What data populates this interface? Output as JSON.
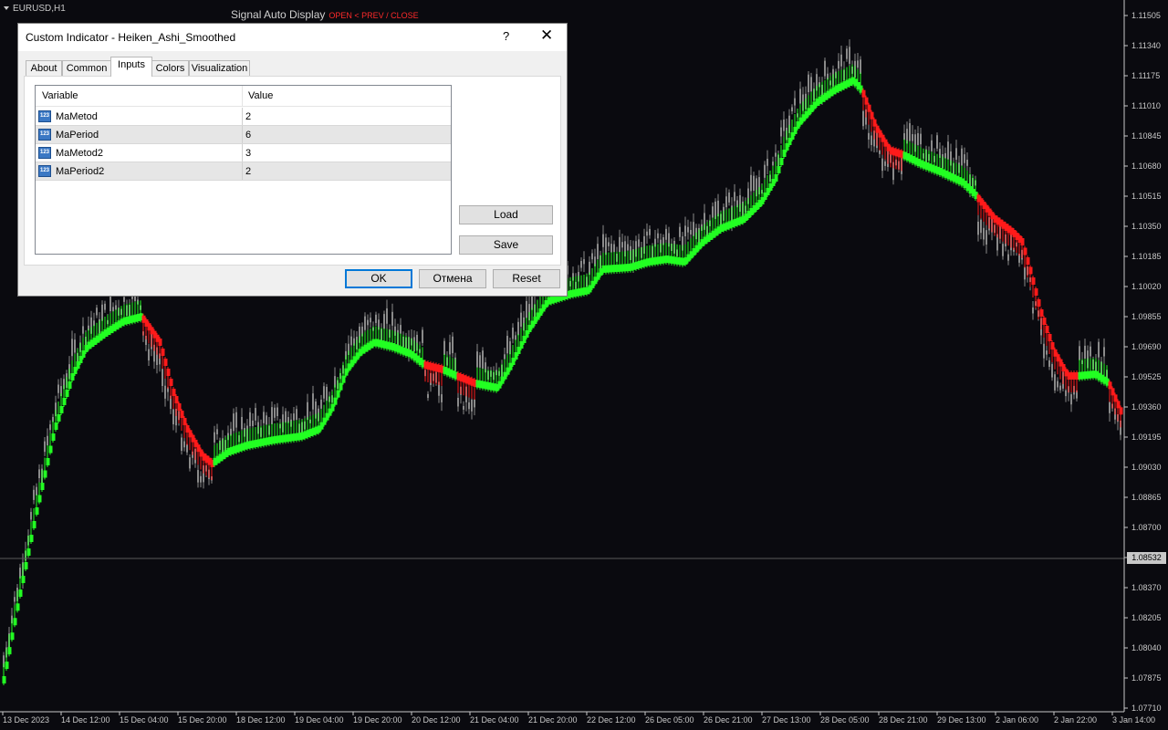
{
  "chart": {
    "symbol": "EURUSD,H1",
    "indicator_label": "Signal Auto Display",
    "indicator_hint": "OPEN < PREV / CLOSE",
    "bull_color": "#22ff22",
    "bear_color": "#ff1a1a",
    "candle_color": "#8a8a8a",
    "current_price": "1.08532",
    "price_axis": [
      "1.11505",
      "1.11340",
      "1.11175",
      "1.11010",
      "1.10845",
      "1.10680",
      "1.10515",
      "1.10350",
      "1.10185",
      "1.10020",
      "1.09855",
      "1.09690",
      "1.09525",
      "1.09360",
      "1.09195",
      "1.09030",
      "1.08865",
      "1.08700",
      "1.08535",
      "1.08370",
      "1.08205",
      "1.08040",
      "1.07875",
      "1.07710"
    ],
    "time_axis": [
      "13 Dec 2023",
      "14 Dec 12:00",
      "15 Dec 04:00",
      "15 Dec 20:00",
      "18 Dec 12:00",
      "19 Dec 04:00",
      "19 Dec 20:00",
      "20 Dec 12:00",
      "21 Dec 04:00",
      "21 Dec 20:00",
      "22 Dec 12:00",
      "26 Dec 05:00",
      "26 Dec 21:00",
      "27 Dec 13:00",
      "28 Dec 05:00",
      "28 Dec 21:00",
      "29 Dec 13:00",
      "2 Jan 06:00",
      "2 Jan 22:00",
      "3 Jan 14:00"
    ]
  },
  "dialog": {
    "title": "Custom Indicator - Heiken_Ashi_Smoothed",
    "help": "?",
    "close": "✕",
    "tabs": [
      "About",
      "Common",
      "Inputs",
      "Colors",
      "Visualization"
    ],
    "active_tab": "Inputs",
    "columns": {
      "variable": "Variable",
      "value": "Value"
    },
    "param_icon_text": "123",
    "params": [
      {
        "name": "MaMetod",
        "value": "2"
      },
      {
        "name": "MaPeriod",
        "value": "6"
      },
      {
        "name": "MaMetod2",
        "value": "3"
      },
      {
        "name": "MaPeriod2",
        "value": "2"
      }
    ],
    "buttons": {
      "load": "Load",
      "save": "Save",
      "ok": "OK",
      "cancel": "Отмена",
      "reset": "Reset"
    }
  }
}
